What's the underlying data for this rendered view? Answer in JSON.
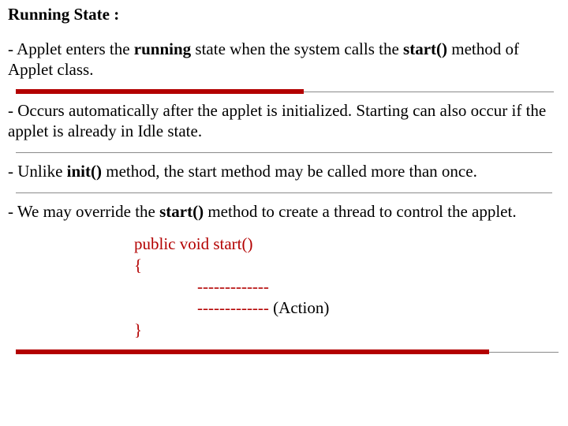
{
  "title": "Running State :",
  "p1": {
    "a": "- Applet enters the ",
    "b": "running",
    "c": " state when the system calls the ",
    "d": "start()",
    "e": " method of Applet class."
  },
  "p2": "- Occurs automatically after the applet is initialized. Starting can also occur if the applet is already in Idle state.",
  "p3": {
    "a": "- Unlike ",
    "b": "init()",
    "c": " method, the start method may be called more than once."
  },
  "p4": {
    "a": "- We may override the ",
    "b": "start()",
    "c": " method to create a thread to control the applet."
  },
  "code": {
    "l1": "public void start()",
    "l2": "{",
    "l3": "-------------",
    "l4a": "------------- ",
    "l4b": "(Action)",
    "l5": "}"
  }
}
